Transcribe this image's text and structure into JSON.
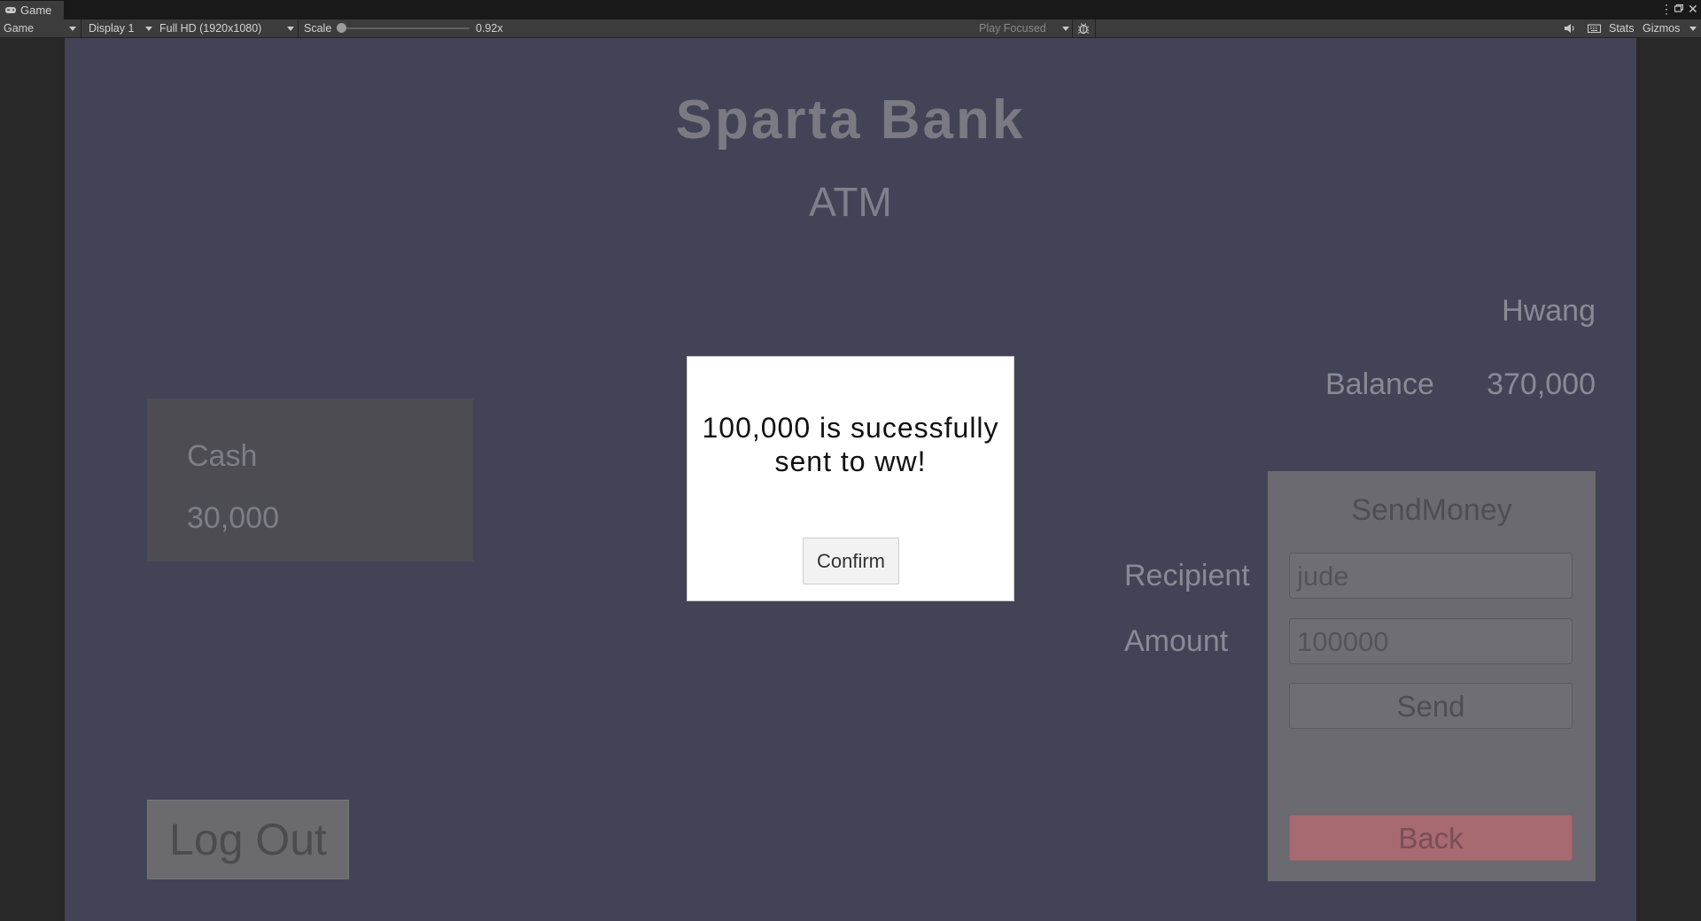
{
  "editor": {
    "tab_label": "Game",
    "tab_icon": "gamepad-icon",
    "window_controls": [
      "more-icon",
      "maximize-icon",
      "close-icon"
    ],
    "toolbar": {
      "view_mode": "Game",
      "display": "Display 1",
      "resolution": "Full HD (1920x1080)",
      "scale_label": "Scale",
      "scale_value": "0.92x",
      "scale_level": 0.05,
      "play_mode": "Play Focused",
      "stats_label": "Stats",
      "gizmos_label": "Gizmos"
    }
  },
  "game": {
    "title": "Sparta Bank",
    "subtitle": "ATM",
    "user_name": "Hwang",
    "balance_label": "Balance",
    "balance_value": "370,000",
    "cash": {
      "label": "Cash",
      "value": "30,000"
    },
    "send_panel": {
      "title": "SendMoney",
      "recipient_label": "Recipient",
      "recipient_value": "jude",
      "amount_label": "Amount",
      "amount_value": "100000",
      "send_label": "Send",
      "back_label": "Back"
    },
    "logout_label": "Log Out",
    "colors": {
      "background": "#434357",
      "back_button": "#a66a70",
      "modal": "#ffffff"
    }
  },
  "modal": {
    "message": "100,000 is sucessfully sent to ww!",
    "confirm_label": "Confirm"
  }
}
